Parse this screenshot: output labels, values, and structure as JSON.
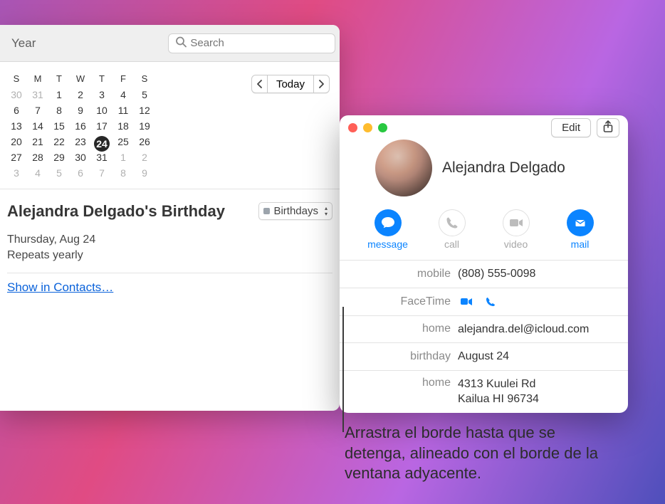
{
  "calendar": {
    "year_label": "Year",
    "search_placeholder": "Search",
    "nav": {
      "prev_glyph": "‹",
      "today_label": "Today",
      "next_glyph": "›"
    },
    "mini_month": {
      "dow": [
        "S",
        "M",
        "T",
        "W",
        "T",
        "F",
        "S"
      ],
      "cells": [
        {
          "n": 30,
          "dim": true
        },
        {
          "n": 31,
          "dim": true
        },
        {
          "n": 1
        },
        {
          "n": 2
        },
        {
          "n": 3
        },
        {
          "n": 4
        },
        {
          "n": 5
        },
        {
          "n": 6
        },
        {
          "n": 7
        },
        {
          "n": 8
        },
        {
          "n": 9
        },
        {
          "n": 10
        },
        {
          "n": 11
        },
        {
          "n": 12
        },
        {
          "n": 13
        },
        {
          "n": 14
        },
        {
          "n": 15
        },
        {
          "n": 16
        },
        {
          "n": 17
        },
        {
          "n": 18
        },
        {
          "n": 19
        },
        {
          "n": 20
        },
        {
          "n": 21
        },
        {
          "n": 22
        },
        {
          "n": 23
        },
        {
          "n": 24,
          "today": true
        },
        {
          "n": 25
        },
        {
          "n": 26
        },
        {
          "n": 27
        },
        {
          "n": 28
        },
        {
          "n": 29
        },
        {
          "n": 30
        },
        {
          "n": 31
        },
        {
          "n": 1,
          "dim": true
        },
        {
          "n": 2,
          "dim": true
        },
        {
          "n": 3,
          "dim": true
        },
        {
          "n": 4,
          "dim": true
        },
        {
          "n": 5,
          "dim": true
        },
        {
          "n": 6,
          "dim": true
        },
        {
          "n": 7,
          "dim": true
        },
        {
          "n": 8,
          "dim": true
        },
        {
          "n": 9,
          "dim": true
        }
      ]
    },
    "event": {
      "title": "Alejandra Delgado's Birthday",
      "calendar_name": "Birthdays",
      "date_line": "Thursday, Aug 24",
      "repeat_line": "Repeats yearly",
      "show_in_contacts": "Show in Contacts…"
    }
  },
  "callout_text": "Arrastra el borde hasta que se detenga, alineado con el borde de la ventana adyacente.",
  "contacts": {
    "edit_label": "Edit",
    "name": "Alejandra Delgado",
    "actions": [
      {
        "id": "message",
        "label": "message",
        "active": true
      },
      {
        "id": "call",
        "label": "call",
        "active": false
      },
      {
        "id": "video",
        "label": "video",
        "active": false
      },
      {
        "id": "mail",
        "label": "mail",
        "active": true
      }
    ],
    "details": {
      "mobile_label": "mobile",
      "mobile_value": "(808) 555-0098",
      "facetime_label": "FaceTime",
      "home_email_label": "home",
      "home_email_value": "alejandra.del@icloud.com",
      "birthday_label": "birthday",
      "birthday_value": "August 24",
      "home_addr_label": "home",
      "home_addr_value": "4313 Kuulei Rd\nKailua HI 96734"
    }
  }
}
